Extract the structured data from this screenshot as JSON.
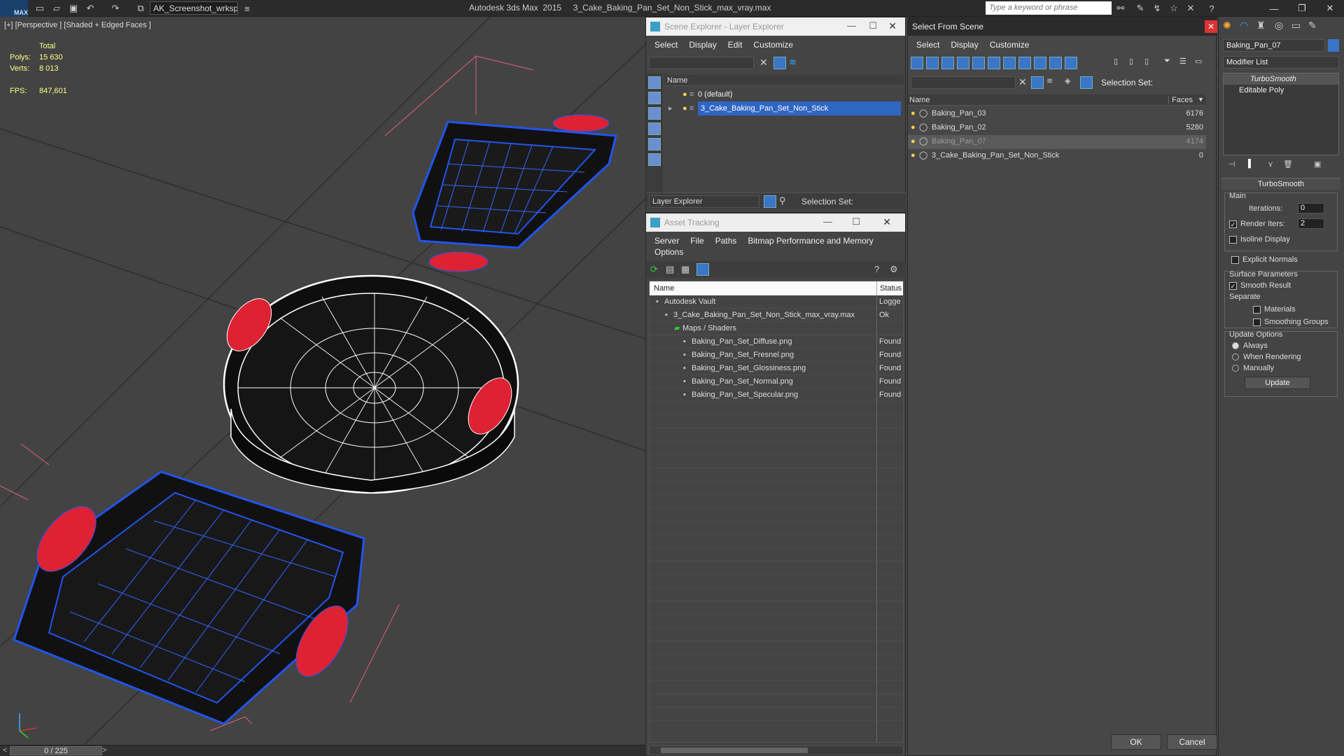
{
  "titlebar": {
    "workspace": "AK_Screenshot_wrksp",
    "app_title": "Autodesk 3ds Max  2015     3_Cake_Baking_Pan_Set_Non_Stick_max_vray.max",
    "search_placeholder": "Type a keyword or phrase",
    "max_label": "MAX"
  },
  "viewport": {
    "label": "[+] [Perspective ] [Shaded + Edged Faces ]",
    "stats": {
      "total_label": "Total",
      "polys_label": "Polys:",
      "polys": "15 630",
      "verts_label": "Verts:",
      "verts": "8 013",
      "fps_label": "FPS:",
      "fps": "847,601"
    },
    "timeslider": "0 / 225"
  },
  "scene_explorer": {
    "title": "Scene Explorer - Layer Explorer",
    "menu": [
      "Select",
      "Display",
      "Edit",
      "Customize"
    ],
    "col_name": "Name",
    "rows": [
      "0 (default)",
      "3_Cake_Baking_Pan_Set_Non_Stick"
    ],
    "footer_label": "Layer Explorer",
    "selection_set": "Selection Set:"
  },
  "asset_tracking": {
    "title": "Asset Tracking",
    "menu": [
      "Server",
      "File",
      "Paths",
      "Bitmap Performance and Memory"
    ],
    "menu2": "Options",
    "col_name": "Name",
    "col_status": "Status",
    "rows": [
      {
        "name": "Autodesk Vault",
        "status": "Logge",
        "indent": 1
      },
      {
        "name": "3_Cake_Baking_Pan_Set_Non_Stick_max_vray.max",
        "status": "Ok",
        "indent": 2
      },
      {
        "name": "Maps / Shaders",
        "status": "",
        "indent": 3
      },
      {
        "name": "Baking_Pan_Set_Diffuse.png",
        "status": "Found",
        "indent": 4
      },
      {
        "name": "Baking_Pan_Set_Fresnel.png",
        "status": "Found",
        "indent": 4
      },
      {
        "name": "Baking_Pan_Set_Glossiness.png",
        "status": "Found",
        "indent": 4
      },
      {
        "name": "Baking_Pan_Set_Normal.png",
        "status": "Found",
        "indent": 4
      },
      {
        "name": "Baking_Pan_Set_Specular.png",
        "status": "Found",
        "indent": 4
      }
    ]
  },
  "select_from_scene": {
    "title": "Select From Scene",
    "menu": [
      "Select",
      "Display",
      "Customize"
    ],
    "selection_set": "Selection Set:",
    "col_name": "Name",
    "col_faces": "Faces",
    "rows": [
      {
        "name": "Baking_Pan_03",
        "faces": "6176"
      },
      {
        "name": "Baking_Pan_02",
        "faces": "5280"
      },
      {
        "name": "Baking_Pan_07",
        "faces": "4174"
      },
      {
        "name": "3_Cake_Baking_Pan_Set_Non_Stick",
        "faces": "0"
      }
    ],
    "ok": "OK",
    "cancel": "Cancel"
  },
  "command_panel": {
    "object_name": "Baking_Pan_07",
    "modifier_list": "Modifier List",
    "stack": [
      "TurboSmooth",
      "Editable Poly"
    ],
    "rollout_title": "TurboSmooth",
    "main_label": "Main",
    "iterations_label": "Iterations:",
    "iterations": "0",
    "render_iters_label": "Render Iters:",
    "render_iters": "2",
    "isoline": "Isoline Display",
    "explicit": "Explicit Normals",
    "surface_params": "Surface Parameters",
    "smooth_result": "Smooth Result",
    "separate": "Separate",
    "materials": "Materials",
    "smoothing_groups": "Smoothing Groups",
    "update_options": "Update Options",
    "always": "Always",
    "when_rendering": "When Rendering",
    "manually": "Manually",
    "update": "Update"
  },
  "colors": {
    "selection": "#2f66c4",
    "wire_blue": "#2255ee",
    "handle_red": "#dd2233",
    "bg": "#444444"
  }
}
